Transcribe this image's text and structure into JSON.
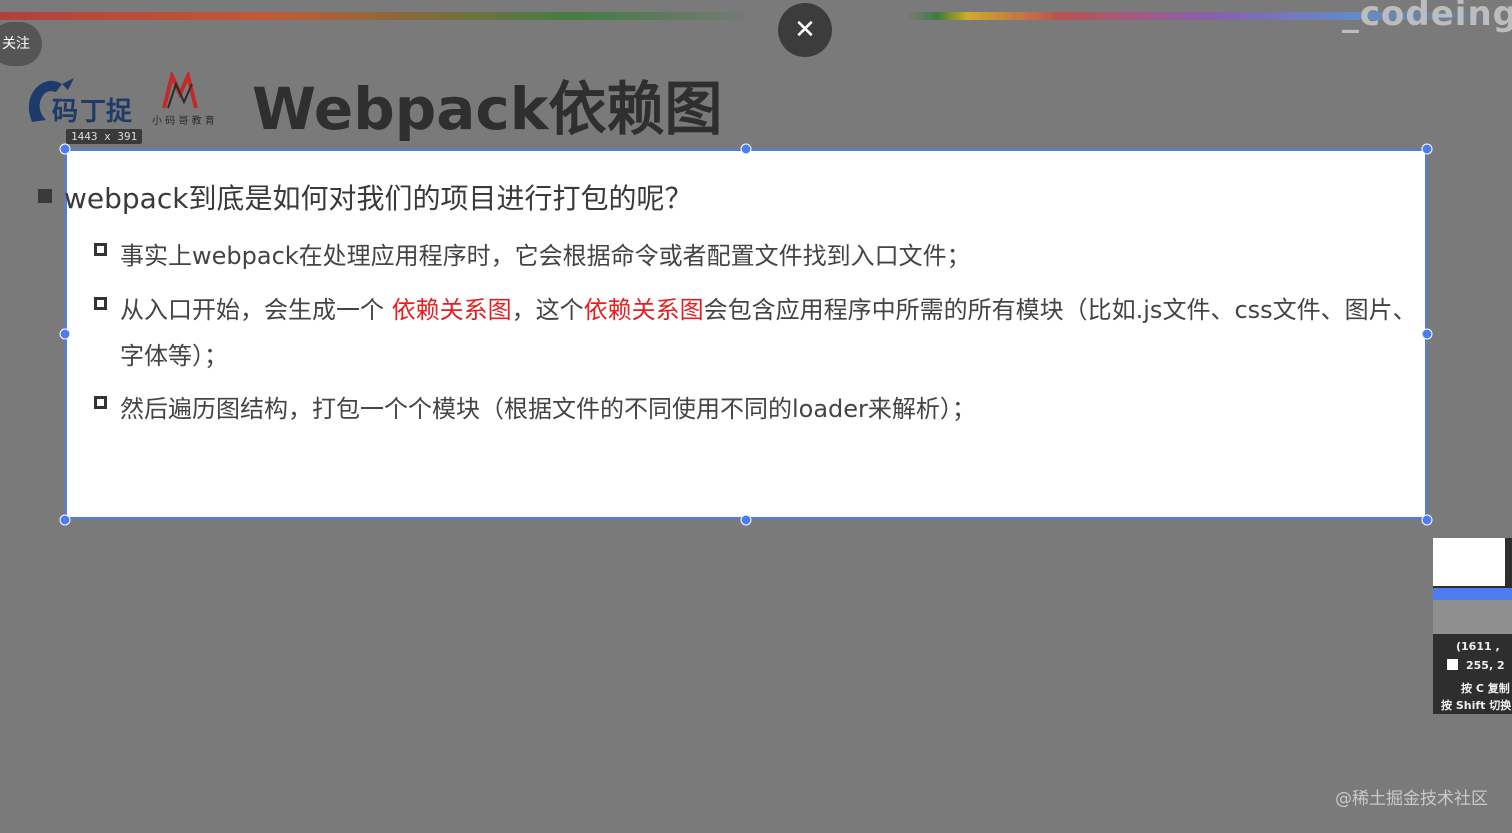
{
  "header": {
    "brand_text": "_codeing",
    "follow_label": "关注",
    "close_symbol": "✕",
    "title": "Webpack依赖图",
    "logo_sub": "小 码 哥 教 育"
  },
  "selection": {
    "dimensions_label": "1443 x 391"
  },
  "slide": {
    "question": "webpack到底是如何对我们的项目进行打包的呢？",
    "items": [
      {
        "text": "事实上webpack在处理应用程序时，它会根据命令或者配置文件找到入口文件；"
      },
      {
        "part1": "从入口开始，会生成一个 ",
        "highlight1": "依赖关系图",
        "part2": "，这个",
        "highlight2": "依赖关系图",
        "part3": "会包含应用程序中所需的所有模块（比如.js文件、css文件、图片、",
        "part4": "字体等）；"
      },
      {
        "text": "然后遍历图结构，打包一个个模块（根据文件的不同使用不同的loader来解析）；"
      }
    ]
  },
  "color_picker": {
    "coords": "(1611 ,",
    "rgb": "255, 2",
    "hint_copy": "按 C 复制",
    "hint_shift": "按 Shift 切换"
  },
  "watermark": "@稀土掘金技术社区",
  "colors": {
    "accent": "#4c7df0",
    "highlight": "#e51f1f",
    "overlay": "#7a7a7a"
  }
}
